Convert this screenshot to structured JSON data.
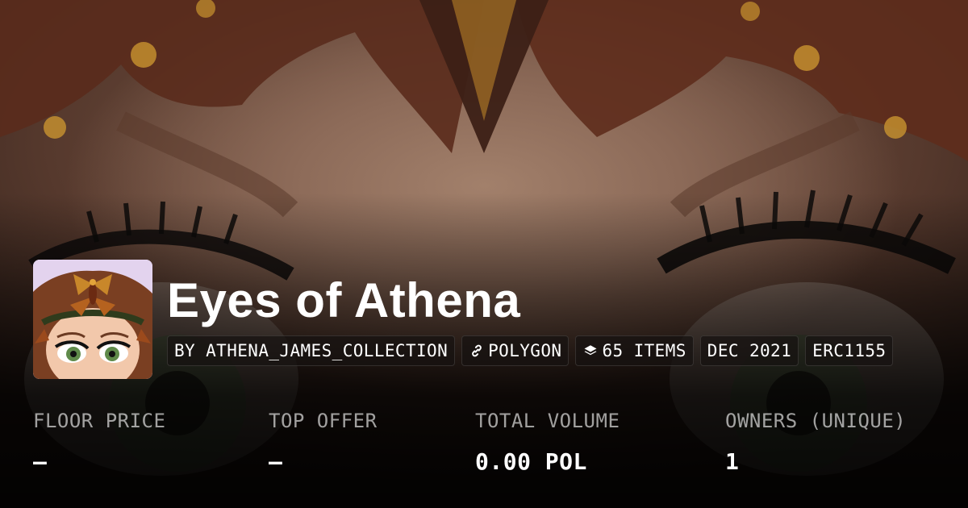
{
  "collection": {
    "name": "Eyes of Athena",
    "avatar_alt": "collection-avatar"
  },
  "tags": [
    {
      "label": "BY ATHENA_JAMES_COLLECTION",
      "icon": ""
    },
    {
      "label": "POLYGON",
      "icon": "link-icon"
    },
    {
      "label": "65 ITEMS",
      "icon": "layers-icon"
    },
    {
      "label": "DEC 2021",
      "icon": ""
    },
    {
      "label": "ERC1155",
      "icon": ""
    }
  ],
  "stats": [
    {
      "label": "FLOOR PRICE",
      "value": "–"
    },
    {
      "label": "TOP OFFER",
      "value": "–"
    },
    {
      "label": "TOTAL VOLUME",
      "value": "0.00 POL"
    },
    {
      "label": "OWNERS (UNIQUE)",
      "value": "1"
    }
  ],
  "colors": {
    "text_primary": "#ffffff",
    "text_muted": "#9e9a98",
    "tag_bg": "#161210"
  }
}
